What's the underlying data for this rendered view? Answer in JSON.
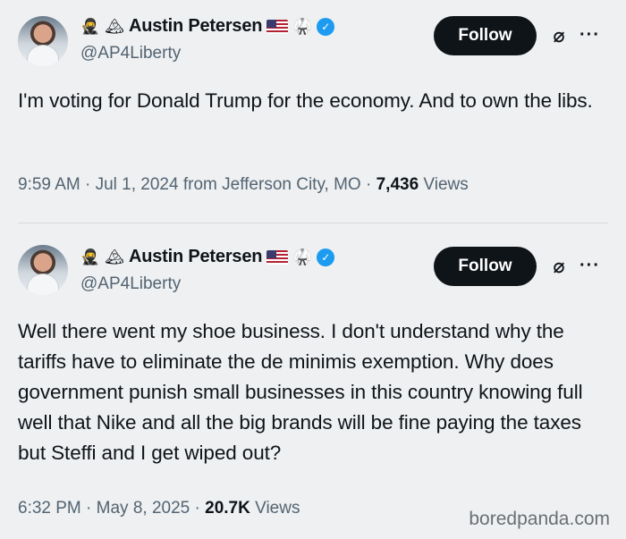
{
  "tweets": [
    {
      "name": "Austin Petersen",
      "handle": "@AP4Liberty",
      "follow_label": "Follow",
      "emojis": [
        "ninja-emoji",
        "mountain-emoji"
      ],
      "badges": [
        "us-flag-icon",
        "karate-gi-icon",
        "verified-badge-icon"
      ],
      "text": "I'm voting for Donald Trump for the economy. And to own the libs.",
      "time": "9:59 AM",
      "date": "Jul 1, 2024",
      "location": "from Jefferson City, MO",
      "views_count": "7,436",
      "views_label": "Views"
    },
    {
      "name": "Austin Petersen",
      "handle": "@AP4Liberty",
      "follow_label": "Follow",
      "emojis": [
        "ninja-emoji",
        "mountain-emoji"
      ],
      "badges": [
        "us-flag-icon",
        "karate-gi-icon",
        "verified-badge-icon"
      ],
      "text": "Well there went my shoe business. I don't understand why the tariffs have to eliminate the de minimis exemption. Why does government punish small businesses in this country knowing full well that Nike and all the big brands will be fine paying the taxes but Steffi and I get wiped out?",
      "time": "6:32 PM",
      "date": "May 8, 2025",
      "location": "",
      "views_count": "20.7K",
      "views_label": "Views"
    }
  ],
  "watermark": "boredpanda.com",
  "colors": {
    "background": "#eef0f2",
    "follow_button": "#0f1419",
    "verified": "#1d9bf0",
    "secondary_text": "#536471"
  }
}
